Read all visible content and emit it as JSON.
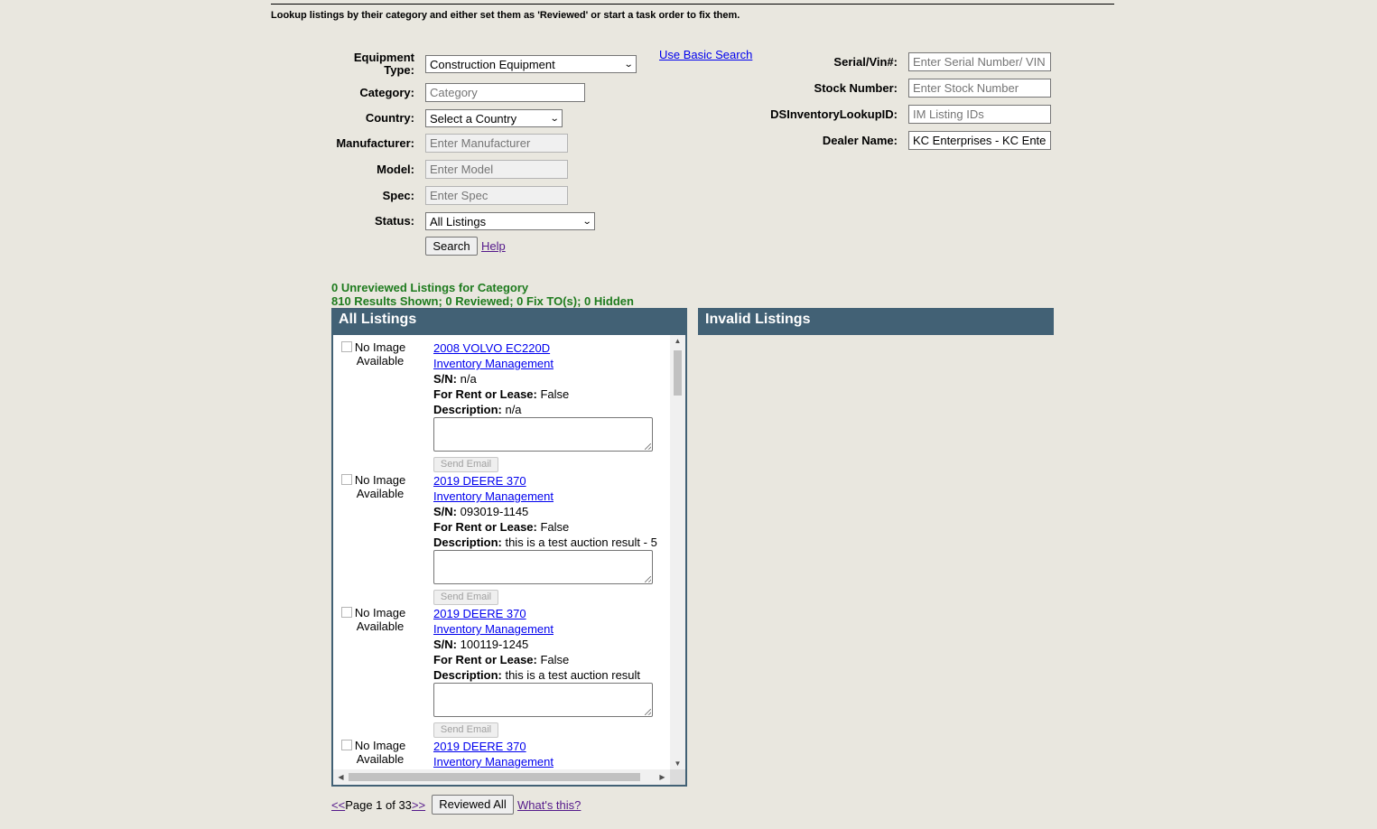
{
  "intro": "Lookup listings by their category and either set them as 'Reviewed' or start a task order to fix them.",
  "form": {
    "equipment_type_label": "Equipment",
    "equipment_type_label2": "Type:",
    "equipment_type_value": "Construction Equipment",
    "category_label": "Category:",
    "category_placeholder": "Category",
    "country_label": "Country:",
    "country_value": "Select a Country",
    "manufacturer_label": "Manufacturer:",
    "manufacturer_placeholder": "Enter Manufacturer",
    "model_label": "Model:",
    "model_placeholder": "Enter Model",
    "spec_label": "Spec:",
    "spec_placeholder": "Enter Spec",
    "status_label": "Status:",
    "status_value": "All Listings",
    "search_button": "Search",
    "help_link": "Help",
    "basic_search_link": "Use Basic Search",
    "serial_label": "Serial/Vin#:",
    "serial_placeholder": "Enter Serial Number/ VIN",
    "stock_label": "Stock Number:",
    "stock_placeholder": "Enter Stock Number",
    "lookup_label": "DSInventoryLookupID:",
    "lookup_placeholder": "IM Listing IDs",
    "dealer_label": "Dealer Name:",
    "dealer_value": "KC Enterprises - KC Enterprises"
  },
  "summary": {
    "unreviewed": "0 Unreviewed Listings for Category",
    "results": "810 Results Shown; 0 Reviewed; 0 Fix TO(s); 0 Hidden"
  },
  "panels": {
    "all_title": "All Listings",
    "invalid_title": "Invalid Listings"
  },
  "labels": {
    "no_image": "No Image Available",
    "inventory_link": "Inventory Management",
    "sn": "S/N:",
    "rent": "For Rent or Lease:",
    "desc": "Description:",
    "send_email": "Send Email"
  },
  "listings": [
    {
      "title": "2008 VOLVO EC220D",
      "sn": "n/a",
      "rent": "False",
      "desc": "n/a"
    },
    {
      "title": "2019 DEERE 370",
      "sn": "093019-1145",
      "rent": "False",
      "desc": "this is a test auction result - 5"
    },
    {
      "title": "2019 DEERE 370",
      "sn": "100119-1245",
      "rent": "False",
      "desc": "this is a test auction result"
    },
    {
      "title": "2019 DEERE 370",
      "sn": "",
      "rent": "",
      "desc": ""
    }
  ],
  "pager": {
    "prev": "<<",
    "page_text": "Page 1 of 33",
    "next": ">>",
    "reviewed_all": "Reviewed All",
    "whats_this": "What's this?"
  }
}
